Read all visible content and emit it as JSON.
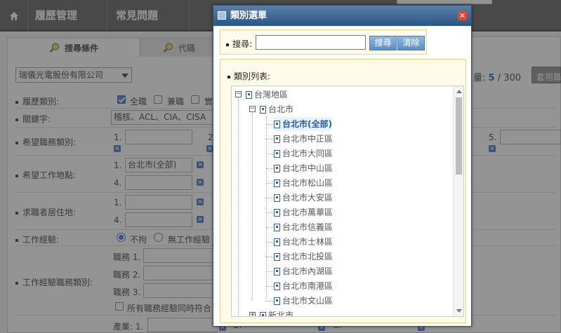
{
  "nav": {
    "home_icon": "home-icon",
    "items": [
      "履歷管理",
      "常見問題"
    ]
  },
  "tabs": {
    "search_conditions": "搜尋條件",
    "second_tab": "代碼"
  },
  "company": {
    "value": "瑞儀光電股份有限公司"
  },
  "quota": {
    "prefix": "量:",
    "used": "5",
    "separator": "/",
    "total": "300"
  },
  "use_button": "套用職",
  "form": {
    "resume_type": {
      "label": "履歷類別:",
      "options": [
        "全職",
        "兼職",
        "實"
      ],
      "checked": [
        true,
        false,
        false
      ]
    },
    "keyword": {
      "label": "關鍵字:",
      "value": "稽核、ACL、CIA、CISA"
    },
    "desired_category": {
      "label": "希望職務類別:",
      "slots": [
        "1.",
        "2",
        "5."
      ]
    },
    "desired_location": {
      "label": "希望工作地點:",
      "slots": [
        "1.",
        "4."
      ],
      "first_value": "台北市(全部)"
    },
    "residence": {
      "label": "求職者居住地:",
      "slots": [
        "1.",
        "4."
      ]
    },
    "experience": {
      "label": "工作經驗:",
      "options": [
        "不拘",
        "無工作經驗"
      ]
    },
    "exp_category": {
      "label": "工作經驗職務類別:",
      "rows": [
        "職務 1.",
        "職務 2.",
        "職務 3."
      ],
      "all_match": "所有職務經驗同時符合"
    },
    "industry": {
      "prefix": "產業: 1.",
      "slots": [
        "2.",
        "3."
      ]
    }
  },
  "dialog": {
    "title": "類別選單",
    "search_label": "搜尋:",
    "search_value": "",
    "search_button": "搜尋",
    "clear_button": "清除",
    "list_label": "類別列表:",
    "tree": [
      {
        "label": "台灣地區",
        "level": 0,
        "toggle": "−"
      },
      {
        "label": "台北市",
        "level": 1,
        "toggle": "−"
      },
      {
        "label": "台北市(全部)",
        "level": 2,
        "selected": true
      },
      {
        "label": "台北市中正區",
        "level": 2
      },
      {
        "label": "台北市大同區",
        "level": 2
      },
      {
        "label": "台北市中山區",
        "level": 2
      },
      {
        "label": "台北市松山區",
        "level": 2
      },
      {
        "label": "台北市大安區",
        "level": 2
      },
      {
        "label": "台北市萬華區",
        "level": 2
      },
      {
        "label": "台北市信義區",
        "level": 2
      },
      {
        "label": "台北市士林區",
        "level": 2
      },
      {
        "label": "台北市北投區",
        "level": 2
      },
      {
        "label": "台北市內湖區",
        "level": 2
      },
      {
        "label": "台北市南港區",
        "level": 2
      },
      {
        "label": "台北市文山區",
        "level": 2
      },
      {
        "label": "新北市",
        "level": 1,
        "toggle": "+"
      }
    ]
  },
  "colors": {
    "accent": "#3a72c4",
    "dialog_title": "#2c5583",
    "selected_text": "#1f5fae"
  }
}
